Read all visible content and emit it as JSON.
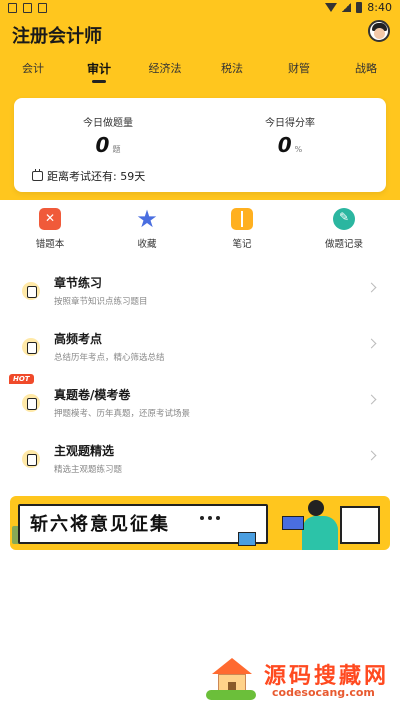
{
  "status_bar": {
    "time": "8:40"
  },
  "app": {
    "title": "注册会计师"
  },
  "tabs": [
    {
      "label": "会计"
    },
    {
      "label": "审计"
    },
    {
      "label": "经济法"
    },
    {
      "label": "税法"
    },
    {
      "label": "财管"
    },
    {
      "label": "战略"
    }
  ],
  "active_tab": "审计",
  "stats": {
    "today_count_label": "今日做题量",
    "today_count_value": "0",
    "today_count_unit": "题",
    "today_score_label": "今日得分率",
    "today_score_value": "0",
    "today_score_unit": "%",
    "countdown": "距离考试还有: 59天"
  },
  "quick_actions": [
    {
      "label": "错题本",
      "icon": "wrong-book-icon",
      "color": "#f05a3a"
    },
    {
      "label": "收藏",
      "icon": "star-icon",
      "color": "#4a6ee0"
    },
    {
      "label": "笔记",
      "icon": "notebook-icon",
      "color": "#ffb020"
    },
    {
      "label": "做题记录",
      "icon": "record-icon",
      "color": "#2bb6a0"
    }
  ],
  "practice_list": [
    {
      "title": "章节练习",
      "subtitle": "按照章节知识点练习题目",
      "icon": "chapter-icon"
    },
    {
      "title": "高频考点",
      "subtitle": "总结历年考点，精心筛选总结",
      "icon": "hot-points-icon"
    },
    {
      "title": "真题卷/模考卷",
      "subtitle": "押题模考、历年真题，还原考试场景",
      "icon": "exam-paper-icon",
      "badge": "HOT"
    },
    {
      "title": "主观题精选",
      "subtitle": "精选主观题练习题",
      "icon": "subjective-icon"
    }
  ],
  "banner": {
    "text": "斩六将意见征集"
  },
  "watermark": {
    "title": "源码搜藏网",
    "url": "codesocang.com"
  },
  "colors": {
    "primary": "#ffc61e",
    "hot": "#f04a2a"
  }
}
